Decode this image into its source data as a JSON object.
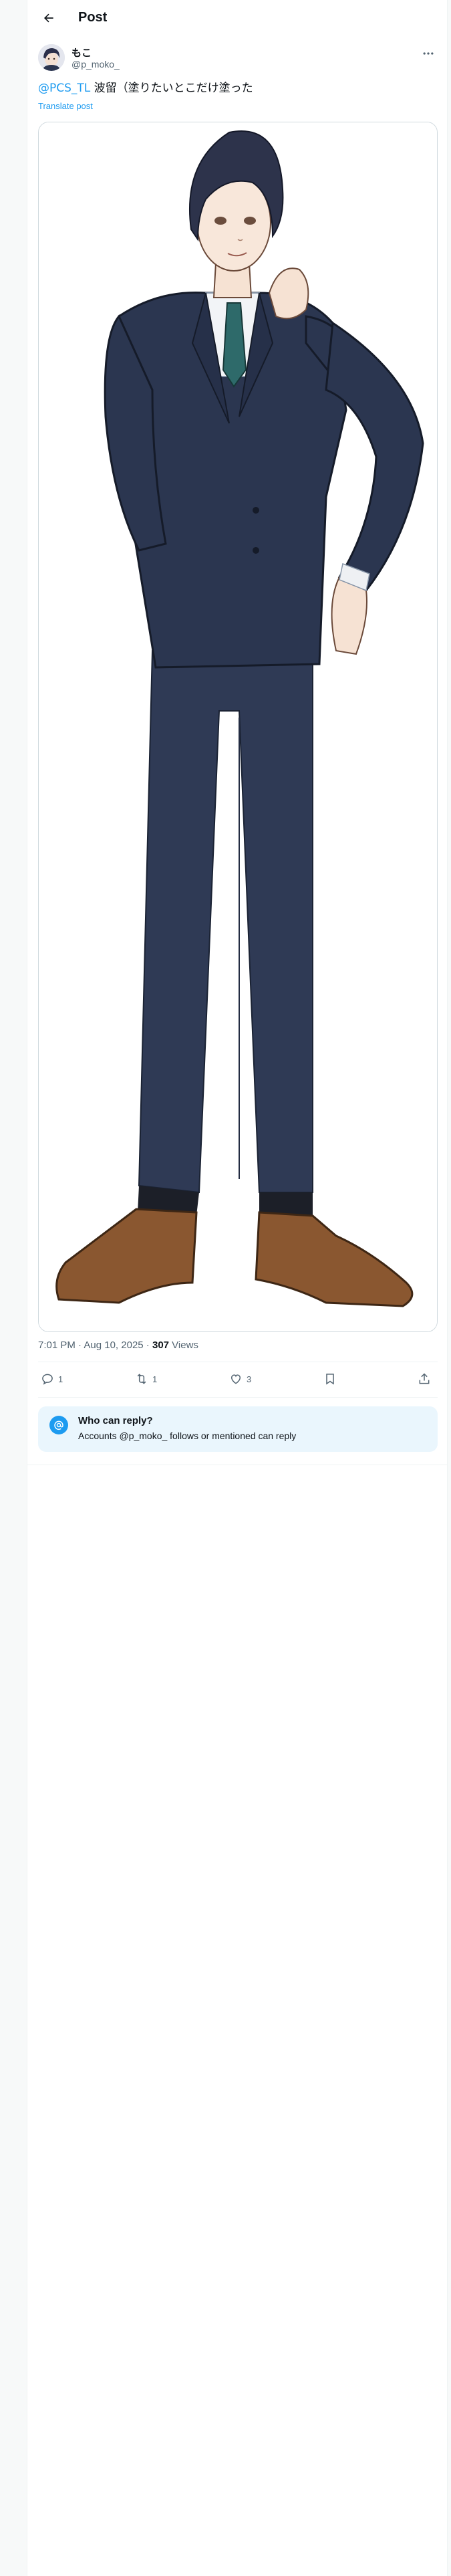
{
  "header": {
    "title": "Post",
    "back_icon": "arrow-left-icon"
  },
  "author": {
    "display_name": "もこ",
    "handle": "@p_moko_",
    "avatar": "avatar-illustration"
  },
  "tweet": {
    "mention": "@PCS_TL",
    "text": " 波留（塗りたいとこだけ塗った",
    "translate_label": "Translate post",
    "media_description_icon": "illustration-image"
  },
  "meta": {
    "time": "7:01 PM",
    "separator": " · ",
    "date": "Aug 10, 2025",
    "views_count": "307",
    "views_label": " Views"
  },
  "actions": {
    "replies": "1",
    "reposts": "1",
    "likes": "3"
  },
  "reply_restriction": {
    "title": "Who can reply?",
    "subtitle": "Accounts @p_moko_ follows or mentioned can reply",
    "icon": "at-sign-icon"
  },
  "colors": {
    "accent": "#1d9bf0",
    "text_primary": "#0f1419",
    "text_secondary": "#536471",
    "reply_box_bg": "#eaf6fd"
  }
}
